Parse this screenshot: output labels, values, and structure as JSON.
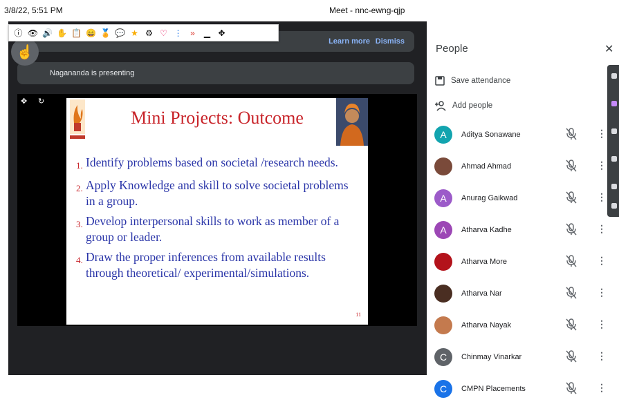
{
  "topbar": {
    "timestamp": "3/8/22, 5:51 PM",
    "meeting": "Meet - nnc-ewng-qjp"
  },
  "banner": {
    "learn_more": "Learn more",
    "dismiss": "Dismiss"
  },
  "toolbar": {
    "icons": [
      "info-icon",
      "eye-icon",
      "speaker-icon",
      "raise-hand-icon",
      "clipboard-icon",
      "emoji-icon",
      "award-icon",
      "chat-icon",
      "star-icon",
      "settings-icon",
      "heart-icon",
      "vertical-dots-icon",
      "double-chevron-icon",
      "minimize-icon",
      "move-icon"
    ]
  },
  "presenter": {
    "text": "Nagananda is presenting"
  },
  "slide": {
    "title": "Mini Projects: Outcome",
    "items": [
      {
        "num": "1.",
        "text": "Identify problems based on societal /research needs."
      },
      {
        "num": "2.",
        "text": "Apply Knowledge and skill to solve societal problems in a group."
      },
      {
        "num": "3.",
        "text": "Develop interpersonal skills to work as member of a group or leader."
      },
      {
        "num": "4.",
        "text": "Draw the proper inferences from available results through theoretical/ experimental/simulations."
      }
    ],
    "page": "11"
  },
  "people": {
    "title": "People",
    "save_attendance": "Save attendance",
    "add_people": "Add people",
    "list": [
      {
        "name": "Aditya Sonawane",
        "initial": "A",
        "color": "#12a4af"
      },
      {
        "name": "Ahmad Ahmad",
        "initial": "",
        "color": "#7a4a3a"
      },
      {
        "name": "Anurag Gaikwad",
        "initial": "A",
        "color": "#9c5bc9"
      },
      {
        "name": "Atharva Kadhe",
        "initial": "A",
        "color": "#9c47b5"
      },
      {
        "name": "Atharva More",
        "initial": "",
        "color": "#b3131b"
      },
      {
        "name": "Atharva Nar",
        "initial": "",
        "color": "#4a2e22"
      },
      {
        "name": "Atharva Nayak",
        "initial": "",
        "color": "#c47a4e"
      },
      {
        "name": "Chinmay Vinarkar",
        "initial": "C",
        "color": "#5f6368"
      },
      {
        "name": "CMPN Placements",
        "initial": "C",
        "color": "#1a73e8"
      }
    ]
  }
}
